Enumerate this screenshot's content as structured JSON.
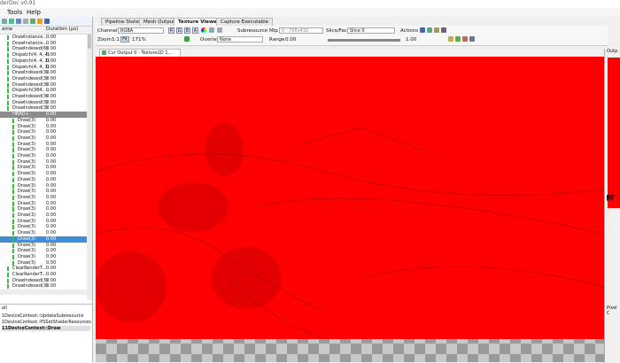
{
  "app": {
    "title": "derDoc v0.91"
  },
  "menu": [
    "Tools",
    "Help"
  ],
  "event_browser": {
    "col_name": "ame",
    "col_duration": "Duration (µs)",
    "rows": [
      {
        "name": "DrawInstance...",
        "dur": "0.00",
        "indent": 14,
        "mark": true
      },
      {
        "name": "DrawInstance...",
        "dur": "0.00",
        "indent": 14,
        "mark": true
      },
      {
        "name": "DrawIndexed(6)",
        "dur": "0.00",
        "indent": 14,
        "mark": true
      },
      {
        "name": "Dispatch(4, 4, 4)",
        "dur": "0.00",
        "indent": 14,
        "mark": true
      },
      {
        "name": "Dispatch(4, 4, 1)",
        "dur": "0.00",
        "indent": 14,
        "mark": true
      },
      {
        "name": "Dispatch(4, 4, 1)",
        "dur": "0.00",
        "indent": 14,
        "mark": true
      },
      {
        "name": "DrawIndexed(3)",
        "dur": "0.00",
        "indent": 14,
        "mark": true
      },
      {
        "name": "DrawIndexed(3)",
        "dur": "0.00",
        "indent": 14,
        "mark": true
      },
      {
        "name": "DrawIndexed(3)",
        "dur": "0.00",
        "indent": 14,
        "mark": true
      },
      {
        "name": "Dispatch(384, ...",
        "dur": "0.00",
        "indent": 14,
        "mark": true
      },
      {
        "name": "DrawIndexed(3)",
        "dur": "0.00",
        "indent": 14,
        "mark": true
      },
      {
        "name": "DrawIndexed(3)",
        "dur": "0.00",
        "indent": 14,
        "mark": true
      },
      {
        "name": "DrawIndexed(3)",
        "dur": "0.00",
        "indent": 14,
        "mark": true
      },
      {
        "name": "HBAO+",
        "dur": "0.00",
        "indent": 14,
        "mark": false,
        "type": "hdr"
      },
      {
        "name": "Draw(3)",
        "dur": "0.00",
        "indent": 20,
        "mark": true
      },
      {
        "name": "Draw(3)",
        "dur": "0.00",
        "indent": 20,
        "mark": true
      },
      {
        "name": "Draw(3)",
        "dur": "0.00",
        "indent": 20,
        "mark": true
      },
      {
        "name": "Draw(3)",
        "dur": "0.00",
        "indent": 20,
        "mark": true
      },
      {
        "name": "Draw(3)",
        "dur": "0.00",
        "indent": 20,
        "mark": true
      },
      {
        "name": "Draw(3)",
        "dur": "0.00",
        "indent": 20,
        "mark": true
      },
      {
        "name": "Draw(3)",
        "dur": "0.00",
        "indent": 20,
        "mark": true
      },
      {
        "name": "Draw(3)",
        "dur": "0.00",
        "indent": 20,
        "mark": true
      },
      {
        "name": "Draw(3)",
        "dur": "0.00",
        "indent": 20,
        "mark": true
      },
      {
        "name": "Draw(3)",
        "dur": "0.00",
        "indent": 20,
        "mark": true
      },
      {
        "name": "Draw(3)",
        "dur": "0.00",
        "indent": 20,
        "mark": true
      },
      {
        "name": "Draw(3)",
        "dur": "0.00",
        "indent": 20,
        "mark": true
      },
      {
        "name": "Draw(3)",
        "dur": "0.00",
        "indent": 20,
        "mark": true
      },
      {
        "name": "Draw(3)",
        "dur": "0.00",
        "indent": 20,
        "mark": true
      },
      {
        "name": "Draw(3)",
        "dur": "0.00",
        "indent": 20,
        "mark": true
      },
      {
        "name": "Draw(3)",
        "dur": "0.00",
        "indent": 20,
        "mark": true
      },
      {
        "name": "Draw(3)",
        "dur": "0.00",
        "indent": 20,
        "mark": true
      },
      {
        "name": "Draw(3)",
        "dur": "0.00",
        "indent": 20,
        "mark": true
      },
      {
        "name": "Draw(3)",
        "dur": "0.00",
        "indent": 20,
        "mark": true
      },
      {
        "name": "Draw(3)",
        "dur": "0.00",
        "indent": 20,
        "mark": true
      },
      {
        "name": "Draw(3)",
        "dur": "0.00",
        "indent": 20,
        "mark": true,
        "type": "sel"
      },
      {
        "name": "Draw(3)",
        "dur": "0.00",
        "indent": 20,
        "mark": true
      },
      {
        "name": "Draw(3)",
        "dur": "0.00",
        "indent": 20,
        "mark": true
      },
      {
        "name": "Draw(3)",
        "dur": "0.00",
        "indent": 20,
        "mark": true
      },
      {
        "name": "Draw(3)",
        "dur": "0.00",
        "indent": 20,
        "mark": true
      },
      {
        "name": "ClearRenderT...",
        "dur": "0.00",
        "indent": 14,
        "mark": true
      },
      {
        "name": "ClearRenderT...",
        "dur": "0.00",
        "indent": 14,
        "mark": true
      },
      {
        "name": "DrawIndexed(3)",
        "dur": "0.00",
        "indent": 14,
        "mark": true
      },
      {
        "name": "DrawIndexed(3)",
        "dur": "0.00",
        "indent": 14,
        "mark": true
      }
    ]
  },
  "callstack": {
    "label": "all",
    "items": [
      "1DeviceContext::UpdateSubresource",
      "1DeviceContext::PSSetShaderResources",
      "11DeviceContext::Draw"
    ]
  },
  "tabs": [
    "Pipeline State",
    "Mesh Output",
    "Texture Viewer",
    "Capture Executable"
  ],
  "toolbar": {
    "channels_label": "Channels",
    "channels_value": "RGBA",
    "r": "R",
    "g": "G",
    "b": "B",
    "a": "A",
    "subresource_label": "Subresource",
    "mip_label": "Mip",
    "mip_value": "0 - 768x432",
    "slice_label": "Slice/Face",
    "slice_value": "Slice 0",
    "actions_label": "Actions",
    "zoom_label": "Zoom",
    "zoom_11": "1:1",
    "fit": "Fit",
    "zoom_value": "171%",
    "overlay_label": "Overlay",
    "overlay_value": "None",
    "range_label": "Range",
    "range_min": "0.00",
    "range_max": "1.00"
  },
  "viewer": {
    "tab_label": "Cur Output 0 - Texture2D 1...",
    "accent": "#ff0000"
  },
  "right": {
    "label": "Outp",
    "rt": "RT",
    "pixel": "Pixel C"
  }
}
